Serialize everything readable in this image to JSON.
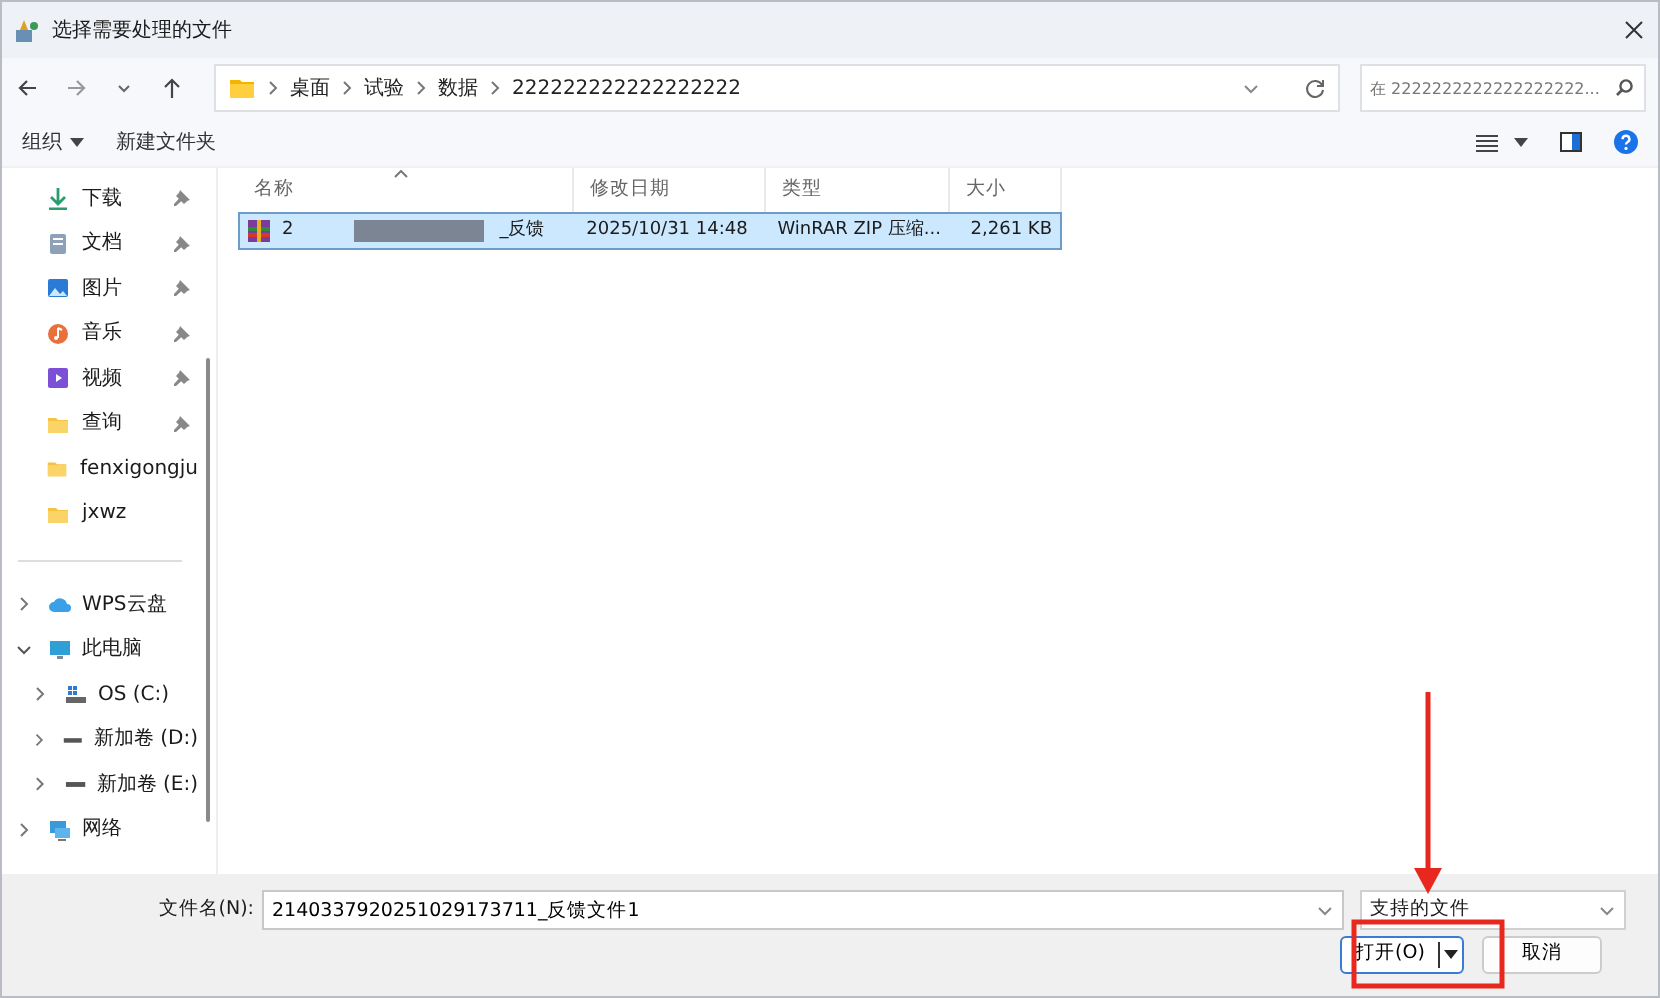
{
  "window": {
    "title": "选择需要处理的文件"
  },
  "address": {
    "crumbs": [
      "桌面",
      "试验",
      "数据",
      "222222222222222222"
    ]
  },
  "search": {
    "placeholder": "在 2222222222222222222..."
  },
  "toolbar": {
    "organize": "组织",
    "new_folder": "新建文件夹"
  },
  "quick_access": [
    {
      "label": "下载",
      "kind": "download",
      "pinned": true
    },
    {
      "label": "文档",
      "kind": "document",
      "pinned": true
    },
    {
      "label": "图片",
      "kind": "pictures",
      "pinned": true
    },
    {
      "label": "音乐",
      "kind": "music",
      "pinned": true
    },
    {
      "label": "视频",
      "kind": "video",
      "pinned": true
    },
    {
      "label": "查询",
      "kind": "folder",
      "pinned": true
    },
    {
      "label": "fenxigongju",
      "kind": "folder",
      "pinned": false
    },
    {
      "label": "jxwz",
      "kind": "folder",
      "pinned": false
    }
  ],
  "tree": [
    {
      "label": "WPS云盘",
      "kind": "cloud",
      "expanded": false
    },
    {
      "label": "此电脑",
      "kind": "pc",
      "expanded": true,
      "children": [
        {
          "label": "OS (C:)",
          "kind": "osdrive",
          "expanded": false
        },
        {
          "label": "新加卷 (D:)",
          "kind": "drive",
          "expanded": false
        },
        {
          "label": "新加卷 (E:)",
          "kind": "drive",
          "expanded": false
        }
      ]
    },
    {
      "label": "网络",
      "kind": "network",
      "expanded": false
    }
  ],
  "table": {
    "columns": [
      "名称",
      "修改日期",
      "类型",
      "大小"
    ],
    "rows": [
      {
        "name": "2",
        "name_tail": "_反馈",
        "date": "2025/10/31 14:48",
        "type": "WinRAR ZIP 压缩...",
        "size": "2,261 KB",
        "selected": true
      }
    ]
  },
  "footer": {
    "filename_label": "文件名(N):",
    "filename": "2140337920251029173711_反馈文件1",
    "filter": "支持的文件",
    "open": "打开(O)",
    "cancel": "取消"
  }
}
